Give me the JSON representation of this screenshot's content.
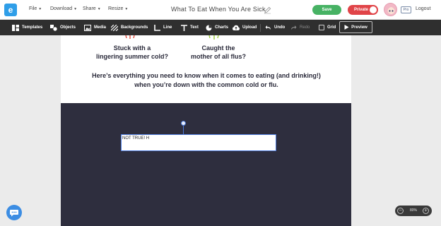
{
  "app": {
    "logo_letter": "e"
  },
  "menu": [
    {
      "label": "File",
      "caret": "▼"
    },
    {
      "label": "Download",
      "caret": "▼"
    },
    {
      "label": "Share",
      "caret": "▼"
    },
    {
      "label": "Resize",
      "caret": "▼"
    }
  ],
  "document": {
    "title": "What To Eat When You Are Sick"
  },
  "header_actions": {
    "save_label": "Save",
    "private_label": "Private",
    "pro_badge": "Pro",
    "logout_label": "Logout"
  },
  "toolbar": {
    "items": [
      {
        "label": "Templates",
        "icon": "templates-icon"
      },
      {
        "label": "Objects",
        "icon": "objects-icon"
      },
      {
        "label": "Media",
        "icon": "media-icon"
      },
      {
        "label": "Backgrounds",
        "icon": "backgrounds-icon"
      },
      {
        "label": "Line",
        "icon": "line-icon"
      },
      {
        "label": "Text",
        "icon": "text-icon"
      },
      {
        "label": "Charts",
        "icon": "charts-icon"
      },
      {
        "label": "Upload",
        "icon": "upload-icon"
      }
    ],
    "undo_label": "Undo",
    "redo_label": "Redo",
    "grid_label": "Grid",
    "preview_label": "Preview"
  },
  "canvas": {
    "stuck_line1": "Stuck with a",
    "stuck_line2": "lingering summer cold?",
    "flu_line1": "Caught the",
    "flu_line2": "mother of all flus?",
    "intro_line1": "Here’s everything you need to know when it comes to eating (and drinking!)",
    "intro_line2": "when you’re down with the common cold or flu.",
    "editing_text": "NOT TRUE! H"
  },
  "zoom": {
    "value": "80%",
    "minus": "−",
    "plus": "+"
  },
  "colors": {
    "accent_blue": "#2f9ee8",
    "save_green": "#47b264",
    "private_red": "#e04448",
    "toolbar_dark": "#2f2f2f",
    "dark_section": "#2e2e3e",
    "selection_blue": "#4a78d8"
  }
}
